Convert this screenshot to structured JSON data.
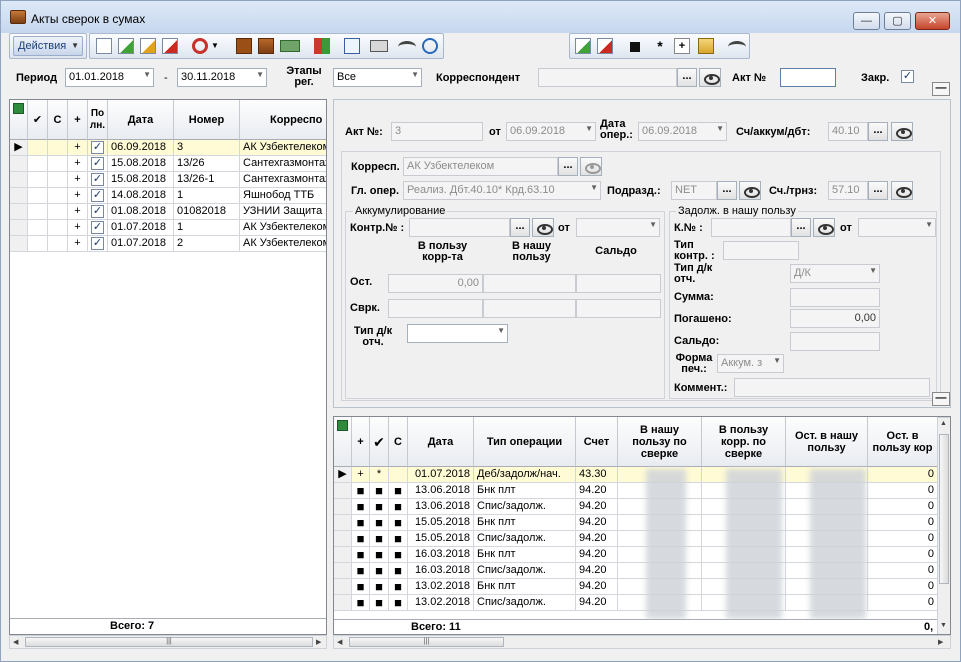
{
  "window": {
    "title": "Акты сверок в сумах",
    "btn_min": "—",
    "btn_max": "▢",
    "btn_close": "✕"
  },
  "toolbar": {
    "actions_label": "Действия"
  },
  "filter": {
    "period_label": "Период",
    "period_from": "01.01.2018",
    "period_sep": "-",
    "period_to": "30.11.2018",
    "stages_label_1": "Этапы",
    "stages_label_2": "рег.",
    "stages_value": "Все",
    "corr_label": "Корреспондент",
    "corr_value": "",
    "dots": "...",
    "akt_label": "Акт №",
    "akt_value": "",
    "closed_label": "Закр.",
    "closed_check": "✓",
    "collapse": "—"
  },
  "left_grid": {
    "headers": [
      "✔",
      "С",
      "+",
      "По лн.",
      "Дата",
      "Номер",
      "Корреспо"
    ],
    "rows": [
      {
        "plus": "+",
        "chk": "✓",
        "date": "06.09.2018",
        "num": "3",
        "corr": "АК Узбектелеком"
      },
      {
        "plus": "+",
        "chk": "✓",
        "date": "15.08.2018",
        "num": "13/26",
        "corr": "Сантехгазмонтаж"
      },
      {
        "plus": "+",
        "chk": "✓",
        "date": "15.08.2018",
        "num": "13/26-1",
        "corr": "Сантехгазмонтаж"
      },
      {
        "plus": "+",
        "chk": "✓",
        "date": "14.08.2018",
        "num": "1",
        "corr": "Яшнобод ТТБ"
      },
      {
        "plus": "+",
        "chk": "✓",
        "date": "01.08.2018",
        "num": "01082018",
        "corr": "УЗНИИ Защита Р"
      },
      {
        "plus": "+",
        "chk": "✓",
        "date": "01.07.2018",
        "num": "1",
        "corr": "АК Узбектелеком"
      },
      {
        "plus": "+",
        "chk": "✓",
        "date": "01.07.2018",
        "num": "2",
        "corr": "АК Узбектелеком"
      }
    ],
    "total": "Всего: 7",
    "scroll_grip": "|||"
  },
  "detail": {
    "akt_no_label": "Акт №:",
    "akt_no_value": "3",
    "from_label": "от",
    "from_value": "06.09.2018",
    "date_oper_label_1": "Дата",
    "date_oper_label_2": "опер.:",
    "date_oper_value": "06.09.2018",
    "account_label": "Сч/аккум/дбт:",
    "account_value": "40.10",
    "corr_label": "Корресп.",
    "corr_value": "АК Узбектелеком",
    "gl_oper_label": "Гл. опер.",
    "gl_oper_value": "Реализ. Дбт.40.10* Крд.63.10",
    "subdiv_label": "Подразд.:",
    "subdiv_value": "NET",
    "transit_label": "Сч./трнз:",
    "transit_value": "57.10",
    "accum_legend": "Аккумулирование",
    "contr_label": "Контр.№ :",
    "contr_from_label": "от",
    "col_corr_1": "В пользу",
    "col_corr_2": "корр-та",
    "col_ours_1": "В нашу",
    "col_ours_2": "пользу",
    "col_saldo": "Сальдо",
    "ost_label": "Ост.",
    "ost_value": "0,00",
    "svrk_label": "Сврк.",
    "type_dk_label_1": "Тип д/к",
    "type_dk_label_2": "отч.",
    "debt_legend": "Задолж. в нашу пользу",
    "kno_label": "К.№ :",
    "kno_from_label": "от",
    "type_contr_label_1": "Тип",
    "type_contr_label_2": "контр. :",
    "type_dk2_label_1": "Тип д/к",
    "type_dk2_label_2": "отч.",
    "type_dk2_value": "Д/К",
    "sum_label": "Сумма:",
    "paid_label": "Погашено:",
    "paid_value": "0,00",
    "saldo_label": "Сальдо:",
    "form_label_1": "Форма",
    "form_label_2": "печ.:",
    "form_value": "Аккум. з",
    "comment_label": "Коммент.:"
  },
  "bottom_grid": {
    "headers": [
      "+",
      "✔",
      "С",
      "Дата",
      "Тип операции",
      "Счет",
      "В нашу пользу по сверке",
      "В пользу корр. по сверке",
      "Ост. в нашу пользу",
      "Ост. в пользу кор"
    ],
    "rows": [
      {
        "c1": "+",
        "c2": "*",
        "c3": "",
        "date": "01.07.2018",
        "type": "Деб/задолж/нач.",
        "acc": "43.30",
        "last": "0"
      },
      {
        "c1": "■",
        "c2": "■",
        "c3": "■",
        "date": "13.06.2018",
        "type": "Бнк плт",
        "acc": "94.20",
        "last": "0"
      },
      {
        "c1": "■",
        "c2": "■",
        "c3": "■",
        "date": "13.06.2018",
        "type": "Спис/задолж.",
        "acc": "94.20",
        "last": "0"
      },
      {
        "c1": "■",
        "c2": "■",
        "c3": "■",
        "date": "15.05.2018",
        "type": "Бнк плт",
        "acc": "94.20",
        "last": "0"
      },
      {
        "c1": "■",
        "c2": "■",
        "c3": "■",
        "date": "15.05.2018",
        "type": "Спис/задолж.",
        "acc": "94.20",
        "last": "0"
      },
      {
        "c1": "■",
        "c2": "■",
        "c3": "■",
        "date": "16.03.2018",
        "type": "Бнк плт",
        "acc": "94.20",
        "last": "0"
      },
      {
        "c1": "■",
        "c2": "■",
        "c3": "■",
        "date": "16.03.2018",
        "type": "Спис/задолж.",
        "acc": "94.20",
        "last": "0"
      },
      {
        "c1": "■",
        "c2": "■",
        "c3": "■",
        "date": "13.02.2018",
        "type": "Бнк плт",
        "acc": "94.20",
        "last": "0"
      },
      {
        "c1": "■",
        "c2": "■",
        "c3": "■",
        "date": "13.02.2018",
        "type": "Спис/задолж.",
        "acc": "94.20",
        "last": "0"
      }
    ],
    "total": "Всего: 11",
    "total_last": "0,",
    "scroll_grip": "|||"
  }
}
